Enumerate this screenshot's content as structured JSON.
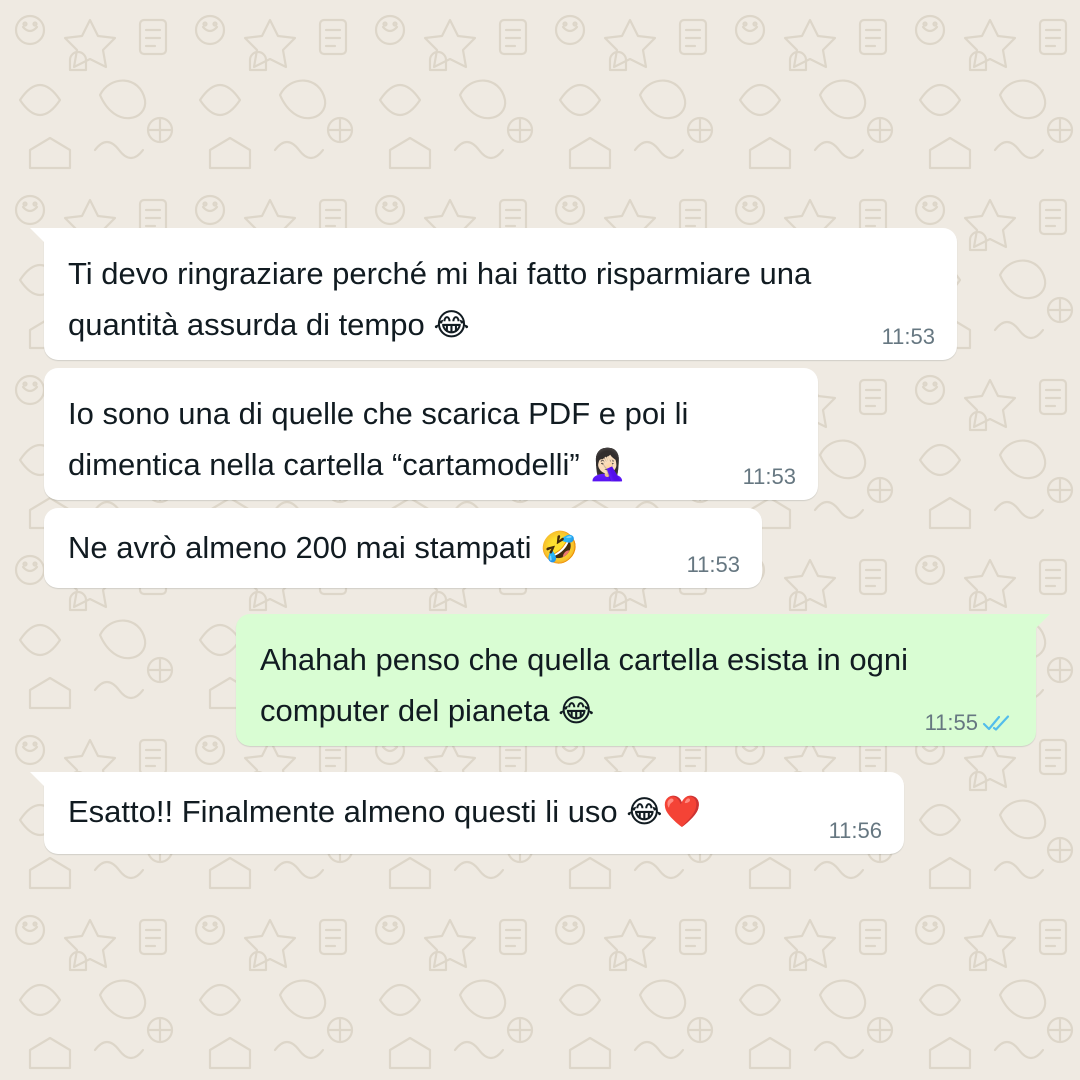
{
  "colors": {
    "wallpaper": "#efeae2",
    "incoming_bubble": "#ffffff",
    "outgoing_bubble": "#d9fdd3",
    "text": "#111b21",
    "timestamp": "#667781",
    "read_ticks": "#53bdeb"
  },
  "messages": [
    {
      "direction": "incoming",
      "text": "Ti devo ringraziare perché mi hai fatto risparmiare una\nquantità assurda di tempo 😂",
      "time": "11:53"
    },
    {
      "direction": "incoming",
      "text": "Io sono una di quelle che scarica PDF e poi li\ndimentica nella cartella “cartamodelli” 🤦🏻‍♀️",
      "time": "11:53"
    },
    {
      "direction": "incoming",
      "text": "Ne avrò almeno 200 mai stampati 🤣",
      "time": "11:53"
    },
    {
      "direction": "outgoing",
      "text": "Ahahah penso che quella cartella esista in ogni\ncomputer del pianeta 😂",
      "time": "11:55",
      "status_icon": "double-check-read-icon"
    },
    {
      "direction": "incoming",
      "text": "Esatto!! Finalmente almeno questi li uso 😂❤️",
      "time": "11:56"
    }
  ]
}
